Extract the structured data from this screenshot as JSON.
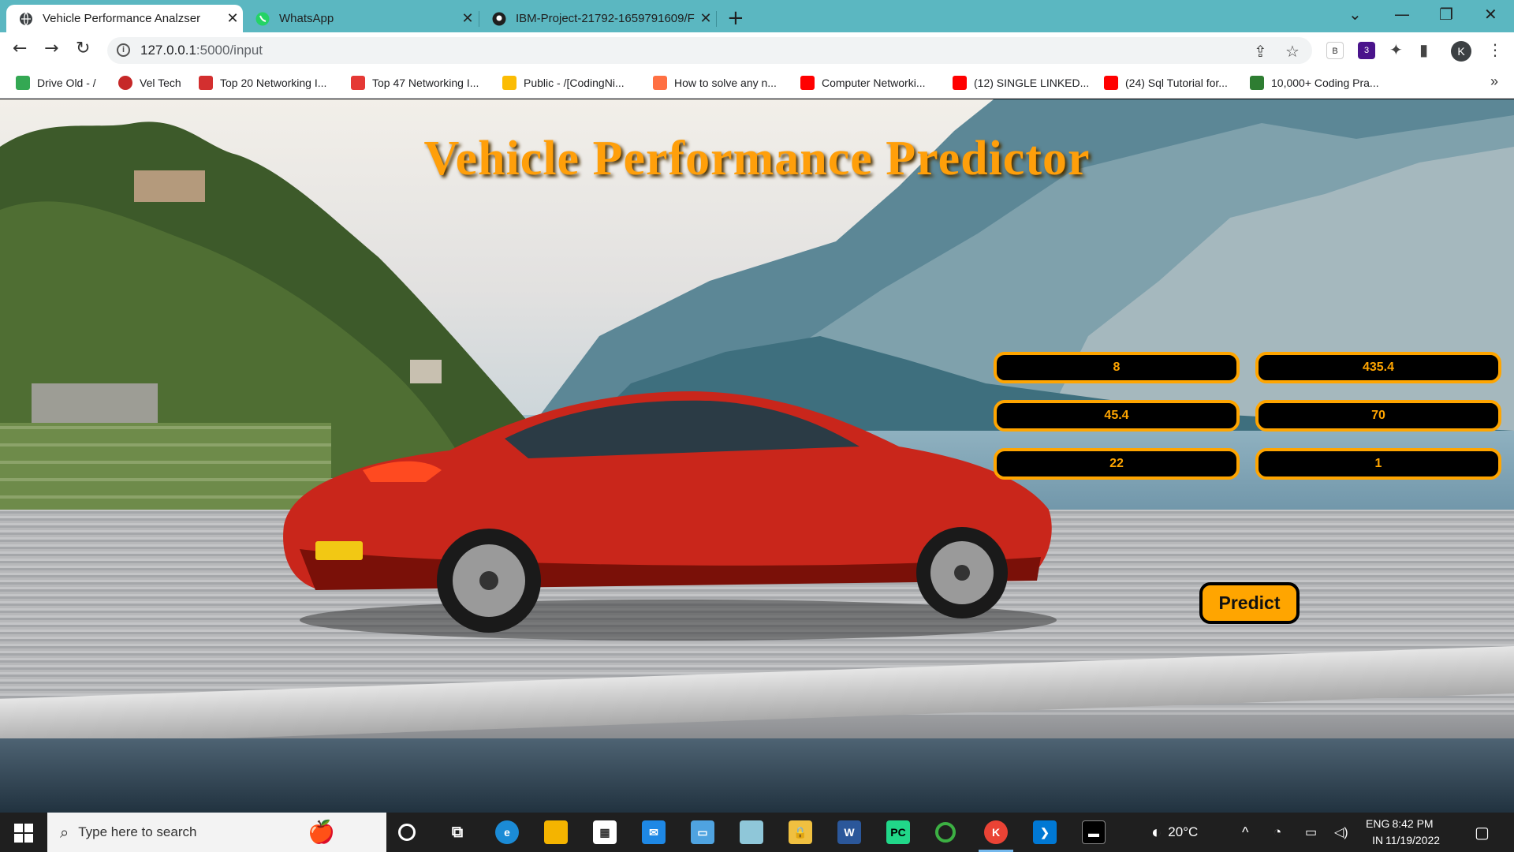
{
  "browser": {
    "tabs": [
      {
        "title": "Vehicle Performance Analzser",
        "active": true,
        "icon": "globe-icon"
      },
      {
        "title": "WhatsApp",
        "active": false,
        "icon": "whatsapp-icon"
      },
      {
        "title": "IBM-Project-21792-1659791609/F",
        "active": false,
        "icon": "github-icon"
      }
    ],
    "url_host": "127.0.0.1",
    "url_path": ":5000/input",
    "profile_initial": "K",
    "extension_badge": "3",
    "bookmarks": [
      {
        "label": "Drive Old - /",
        "color": "#34a853"
      },
      {
        "label": "Vel Tech",
        "color": "#c62828"
      },
      {
        "label": "Top 20 Networking I...",
        "color": "#d32f2f"
      },
      {
        "label": "Top 47 Networking I...",
        "color": "#e53935"
      },
      {
        "label": "Public - /[CodingNi...",
        "color": "#fbbc04"
      },
      {
        "label": "How to solve any n...",
        "color": "#ff7043"
      },
      {
        "label": "Computer Networki...",
        "color": "#ff0000"
      },
      {
        "label": "(12) SINGLE LINKED...",
        "color": "#ff0000"
      },
      {
        "label": "(24) Sql Tutorial for...",
        "color": "#ff0000"
      },
      {
        "label": "10,000+ Coding Pra...",
        "color": "#2e7d32"
      }
    ]
  },
  "page": {
    "title": "Vehicle Performance Predictor",
    "fields": [
      "8",
      "435.4",
      "45.4",
      "70",
      "22",
      "1"
    ],
    "predict_label": "Predict",
    "accent_color": "#ffa500"
  },
  "taskbar": {
    "search_placeholder": "Type here to search",
    "weather": "20°C",
    "lang_1": "ENG",
    "lang_2": "IN",
    "time": "8:42 PM",
    "date": "11/19/2022"
  }
}
